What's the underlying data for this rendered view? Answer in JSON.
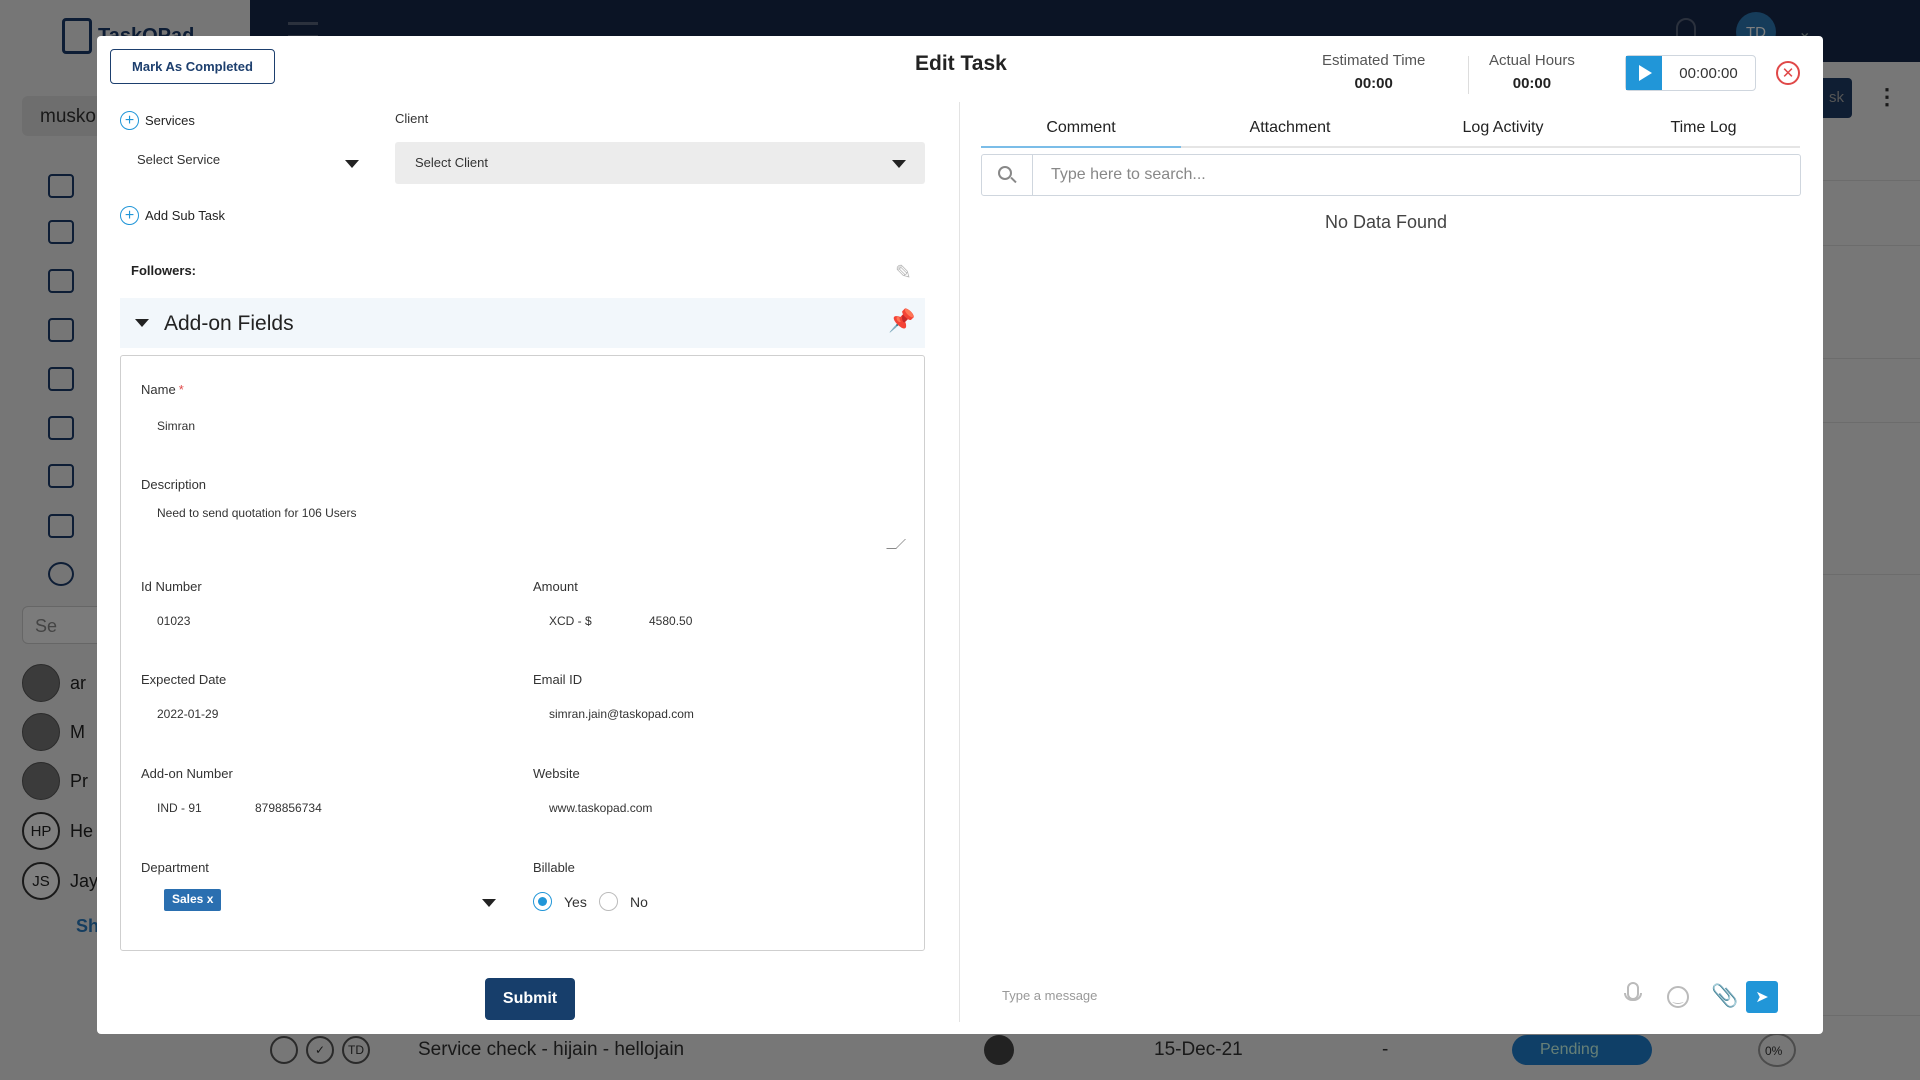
{
  "background": {
    "app_name": "TaskOPad",
    "user_pill": "musko",
    "search_placeholder": "Se",
    "people": [
      {
        "initials": "",
        "name": "ar"
      },
      {
        "initials": "",
        "name": "M"
      },
      {
        "initials": "",
        "name": "Pr"
      },
      {
        "initials": "HP",
        "name": "He"
      },
      {
        "initials": "JS",
        "name": "Jay"
      }
    ],
    "show_more": "Sh",
    "avatar_initials": "TD",
    "add_button": "sk",
    "task_row": {
      "initials": "TD",
      "title": "Service check - hijain - hellojain",
      "date": "15-Dec-21",
      "dash": "-",
      "status": "Pending",
      "percent": "0%"
    }
  },
  "modal": {
    "mark_completed": "Mark As Completed",
    "title": "Edit Task",
    "estimated_time": {
      "label": "Estimated Time",
      "value": "00:00"
    },
    "actual_hours": {
      "label": "Actual Hours",
      "value": "00:00"
    },
    "timer": "00:00:00",
    "services_label": "Services",
    "service_select": "Select Service",
    "client_label": "Client",
    "client_select": "Select Client",
    "add_sub_task": "Add Sub Task",
    "followers_label": "Followers:",
    "addon_title": "Add-on Fields",
    "fields": {
      "name": {
        "label": "Name",
        "value": "Simran"
      },
      "description": {
        "label": "Description",
        "value": "Need to send quotation for 106 Users"
      },
      "id_number": {
        "label": "Id Number",
        "value": "01023"
      },
      "amount": {
        "label": "Amount",
        "currency": "XCD - $",
        "value": "4580.50"
      },
      "expected_date": {
        "label": "Expected Date",
        "value": "2022-01-29"
      },
      "email": {
        "label": "Email ID",
        "value": "simran.jain@taskopad.com"
      },
      "addon_number": {
        "label": "Add-on Number",
        "code": "IND - 91",
        "value": "8798856734"
      },
      "website": {
        "label": "Website",
        "value": "www.taskopad.com"
      },
      "department": {
        "label": "Department",
        "chip": "Sales x"
      },
      "billable": {
        "label": "Billable",
        "yes": "Yes",
        "no": "No",
        "selected": "Yes"
      }
    },
    "submit": "Submit",
    "tabs": [
      "Comment",
      "Attachment",
      "Log Activity",
      "Time Log"
    ],
    "active_tab": "Comment",
    "search_placeholder": "Type here to search...",
    "no_data": "No Data Found",
    "message_placeholder": "Type a message"
  },
  "colors": {
    "primary": "#173e6b",
    "accent": "#2196d8",
    "danger": "#e04848"
  }
}
